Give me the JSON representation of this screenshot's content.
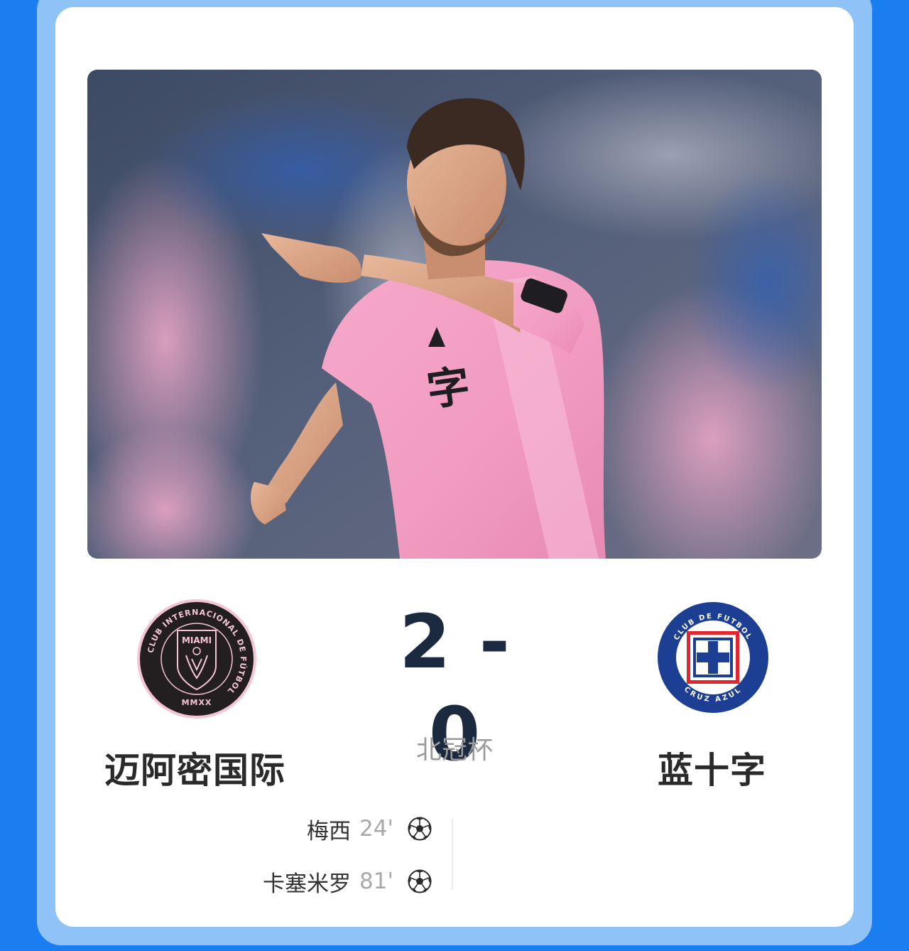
{
  "match": {
    "home_team": "迈阿密国际",
    "away_team": "蓝十字",
    "score": "2 - 0",
    "competition": "北冠杯"
  },
  "crests": {
    "home": {
      "ring_text": "CLUB INTERNACIONAL DE FÚTBOL",
      "name": "MIAMI",
      "year": "MMXX"
    },
    "away": {
      "top_text": "CLUB DE FUTBOL",
      "bottom_text": "CRUZ AZUL"
    }
  },
  "goals": [
    {
      "player": "梅西",
      "minute": "24'",
      "icon": "soccer-ball-icon"
    },
    {
      "player": "卡塞米罗",
      "minute": "81'",
      "icon": "soccer-ball-icon"
    }
  ],
  "colors": {
    "page_bg": "#1a7ef0",
    "frame": "#8fc3f8",
    "home_pink": "#f2b6cf",
    "home_black": "#231f20",
    "away_blue": "#1c3f94",
    "away_red": "#e0262f"
  }
}
